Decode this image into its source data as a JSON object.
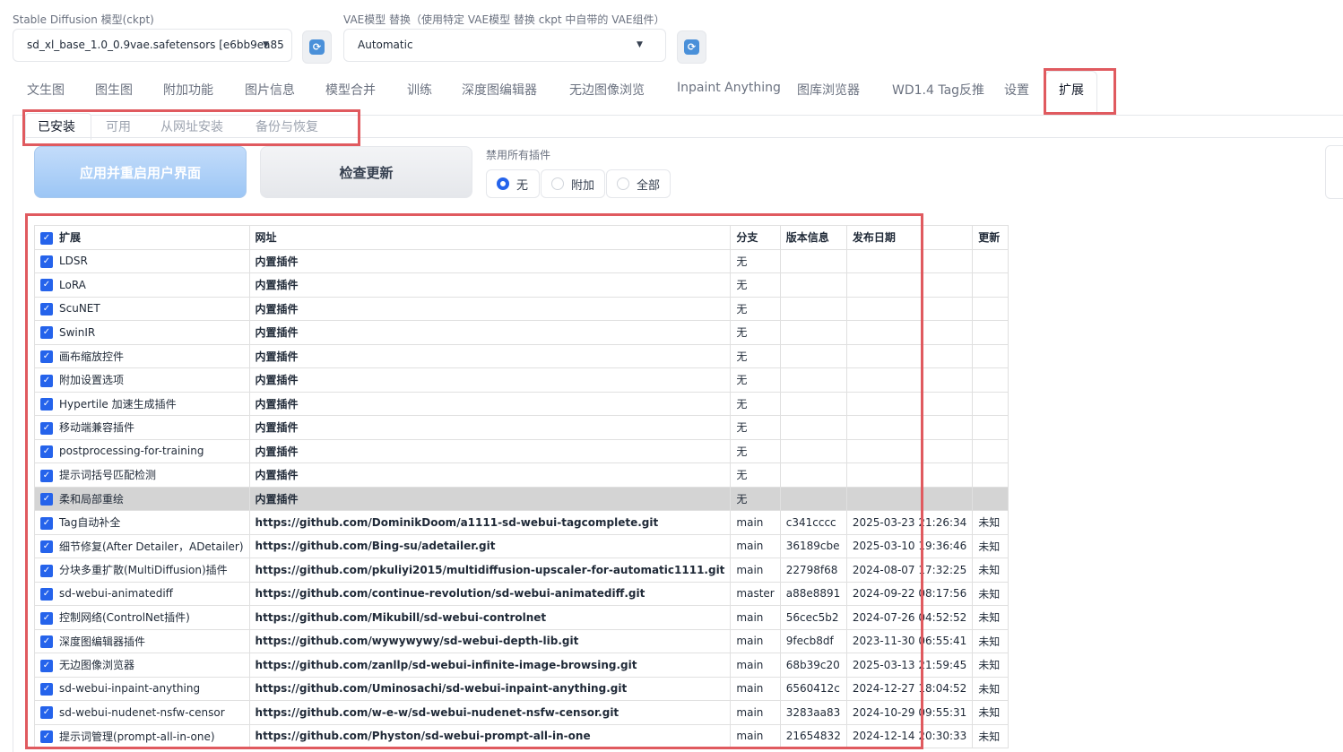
{
  "model_selector": {
    "label": "Stable Diffusion 模型(ckpt)",
    "value": "sd_xl_base_1.0_0.9vae.safetensors [e6bb9ea85"
  },
  "vae_selector": {
    "label": "VAE模型 替换（使用特定 VAE模型 替换 ckpt 中自带的 VAE组件）",
    "value": "Automatic"
  },
  "main_tabs": [
    {
      "label": "文生图"
    },
    {
      "label": "图生图"
    },
    {
      "label": "附加功能"
    },
    {
      "label": "图片信息"
    },
    {
      "label": "模型合并"
    },
    {
      "label": "训练"
    },
    {
      "label": "深度图编辑器"
    },
    {
      "label": "无边图像浏览"
    },
    {
      "label": "Inpaint Anything"
    },
    {
      "label": "图库浏览器"
    },
    {
      "label": "WD1.4 Tag反推"
    },
    {
      "label": "设置"
    },
    {
      "label": "扩展"
    }
  ],
  "sub_tabs": [
    {
      "label": "已安装"
    },
    {
      "label": "可用"
    },
    {
      "label": "从网址安装"
    },
    {
      "label": "备份与恢复"
    }
  ],
  "buttons": {
    "apply_restart": "应用并重启用户界面",
    "check_updates": "检查更新"
  },
  "disable_all": {
    "label": "禁用所有插件",
    "options": [
      "无",
      "附加",
      "全部"
    ],
    "selected": "无"
  },
  "table": {
    "headers": [
      "扩展",
      "网址",
      "分支",
      "版本信息",
      "发布日期",
      "更新"
    ],
    "rows": [
      {
        "name": "LDSR",
        "url": "内置插件",
        "branch": "无",
        "version": "",
        "date": "",
        "update": ""
      },
      {
        "name": "LoRA",
        "url": "内置插件",
        "branch": "无",
        "version": "",
        "date": "",
        "update": ""
      },
      {
        "name": "ScuNET",
        "url": "内置插件",
        "branch": "无",
        "version": "",
        "date": "",
        "update": ""
      },
      {
        "name": "SwinIR",
        "url": "内置插件",
        "branch": "无",
        "version": "",
        "date": "",
        "update": ""
      },
      {
        "name": "画布缩放控件",
        "url": "内置插件",
        "branch": "无",
        "version": "",
        "date": "",
        "update": ""
      },
      {
        "name": "附加设置选项",
        "url": "内置插件",
        "branch": "无",
        "version": "",
        "date": "",
        "update": ""
      },
      {
        "name": "Hypertile 加速生成插件",
        "url": "内置插件",
        "branch": "无",
        "version": "",
        "date": "",
        "update": ""
      },
      {
        "name": "移动端兼容插件",
        "url": "内置插件",
        "branch": "无",
        "version": "",
        "date": "",
        "update": ""
      },
      {
        "name": "postprocessing-for-training",
        "url": "内置插件",
        "branch": "无",
        "version": "",
        "date": "",
        "update": ""
      },
      {
        "name": "提示词括号匹配检测",
        "url": "内置插件",
        "branch": "无",
        "version": "",
        "date": "",
        "update": ""
      },
      {
        "name": "柔和局部重绘",
        "url": "内置插件",
        "branch": "无",
        "version": "",
        "date": "",
        "update": ""
      },
      {
        "name": "Tag自动补全",
        "url": "https://github.com/DominikDoom/a1111-sd-webui-tagcomplete.git",
        "branch": "main",
        "version": "c341cccc",
        "date": "2025-03-23 21:26:34",
        "update": "未知"
      },
      {
        "name": "细节修复(After Detailer，ADetailer)",
        "url": "https://github.com/Bing-su/adetailer.git",
        "branch": "main",
        "version": "36189cbe",
        "date": "2025-03-10 19:36:46",
        "update": "未知"
      },
      {
        "name": "分块多重扩散(MultiDiffusion)插件",
        "url": "https://github.com/pkuliyi2015/multidiffusion-upscaler-for-automatic1111.git",
        "branch": "main",
        "version": "22798f68",
        "date": "2024-08-07 17:32:25",
        "update": "未知"
      },
      {
        "name": "sd-webui-animatediff",
        "url": "https://github.com/continue-revolution/sd-webui-animatediff.git",
        "branch": "master",
        "version": "a88e8891",
        "date": "2024-09-22 08:17:56",
        "update": "未知"
      },
      {
        "name": "控制网络(ControlNet插件)",
        "url": "https://github.com/Mikubill/sd-webui-controlnet",
        "branch": "main",
        "version": "56cec5b2",
        "date": "2024-07-26 04:52:52",
        "update": "未知"
      },
      {
        "name": "深度图编辑器插件",
        "url": "https://github.com/wywywywy/sd-webui-depth-lib.git",
        "branch": "main",
        "version": "9fecb8df",
        "date": "2023-11-30 06:55:41",
        "update": "未知"
      },
      {
        "name": "无边图像浏览器",
        "url": "https://github.com/zanllp/sd-webui-infinite-image-browsing.git",
        "branch": "main",
        "version": "68b39c20",
        "date": "2025-03-13 21:59:45",
        "update": "未知"
      },
      {
        "name": "sd-webui-inpaint-anything",
        "url": "https://github.com/Uminosachi/sd-webui-inpaint-anything.git",
        "branch": "main",
        "version": "6560412c",
        "date": "2024-12-27 18:04:52",
        "update": "未知"
      },
      {
        "name": "sd-webui-nudenet-nsfw-censor",
        "url": "https://github.com/w-e-w/sd-webui-nudenet-nsfw-censor.git",
        "branch": "main",
        "version": "3283aa83",
        "date": "2024-10-29 09:55:31",
        "update": "未知"
      },
      {
        "name": "提示词管理(prompt-all-in-one)",
        "url": "https://github.com/Physton/sd-webui-prompt-all-in-one",
        "branch": "main",
        "version": "21654832",
        "date": "2024-12-14 20:30:33",
        "update": "未知"
      }
    ]
  },
  "colors": {
    "accent": "#2563eb",
    "highlight_box": "#e05a5f",
    "selected_row": "#d4d4d4"
  }
}
